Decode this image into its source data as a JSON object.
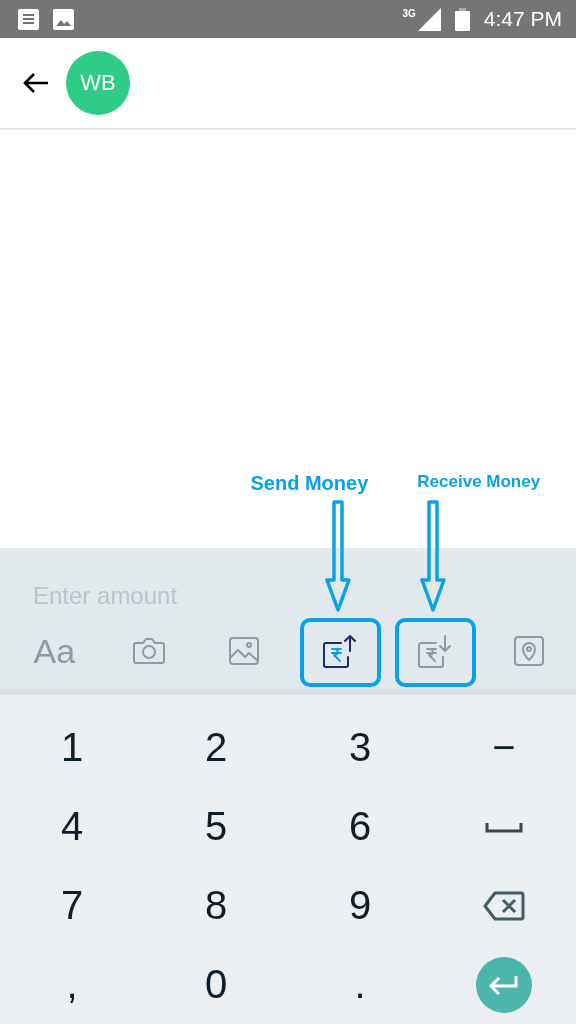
{
  "status_bar": {
    "network": "3G",
    "time": "4:47 PM"
  },
  "header": {
    "avatar_initials": "WB"
  },
  "composer": {
    "placeholder": "Enter amount"
  },
  "toolbar": [
    {
      "kind": "text",
      "label": "Aa",
      "selected": false
    },
    {
      "kind": "camera",
      "selected": false
    },
    {
      "kind": "image",
      "selected": false
    },
    {
      "kind": "send_money",
      "selected": true,
      "annotation": "Send Money"
    },
    {
      "kind": "receive_money",
      "selected": false,
      "annotation": "Receive Money"
    },
    {
      "kind": "location",
      "selected": false
    }
  ],
  "keyboard": [
    {
      "kind": "char",
      "label": "1"
    },
    {
      "kind": "char",
      "label": "2"
    },
    {
      "kind": "char",
      "label": "3"
    },
    {
      "kind": "char",
      "label": "−"
    },
    {
      "kind": "char",
      "label": "4"
    },
    {
      "kind": "char",
      "label": "5"
    },
    {
      "kind": "char",
      "label": "6"
    },
    {
      "kind": "space"
    },
    {
      "kind": "char",
      "label": "7"
    },
    {
      "kind": "char",
      "label": "8"
    },
    {
      "kind": "char",
      "label": "9"
    },
    {
      "kind": "backspace"
    },
    {
      "kind": "char",
      "label": ","
    },
    {
      "kind": "char",
      "label": "0"
    },
    {
      "kind": "char",
      "label": "."
    },
    {
      "kind": "enter"
    }
  ]
}
